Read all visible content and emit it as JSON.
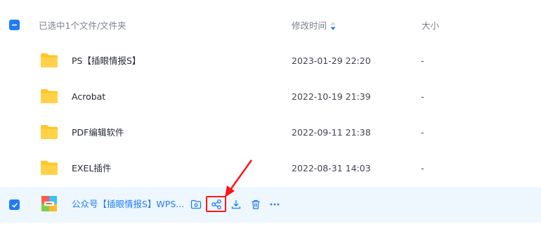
{
  "header": {
    "selected_label": "已选中1个文件/文件夹",
    "col_time": "修改时间",
    "col_size": "大小"
  },
  "rows": [
    {
      "name": "PS【插眼情报S】",
      "time": "2023-01-29 22:20",
      "size": "-",
      "icon": "folder-icon"
    },
    {
      "name": "Acrobat",
      "time": "2022-10-19 21:39",
      "size": "-",
      "icon": "folder-icon"
    },
    {
      "name": "PDF编辑软件",
      "time": "2022-09-11 21:38",
      "size": "-",
      "icon": "folder-icon"
    },
    {
      "name": "EXEL插件",
      "time": "2022-08-31 14:03",
      "size": "-",
      "icon": "folder-icon"
    },
    {
      "name": "公众号【插眼情报S】WPS...",
      "icon": "archive-file-icon",
      "selected": true
    }
  ],
  "actions": [
    "move-to-folder-icon",
    "share-icon",
    "download-icon",
    "delete-icon",
    "more-icon"
  ],
  "colors": {
    "accent": "#1f7cf6",
    "selected_bg": "#eff7fe",
    "folder": "#ffc72b",
    "highlight": "#ff1515"
  }
}
